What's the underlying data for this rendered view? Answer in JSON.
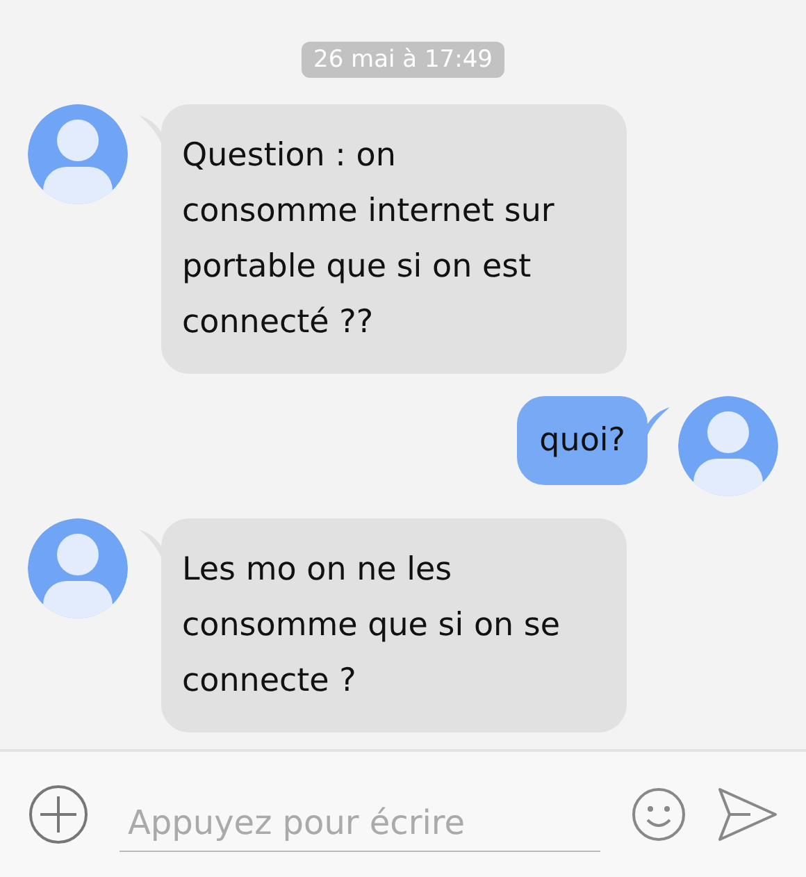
{
  "timestamp": "26 mai à 17:49",
  "messages": [
    {
      "kind": "received",
      "text": "Question : on consomme internet sur portable que si on est connecté ??"
    },
    {
      "kind": "sent",
      "text": "quoi?"
    },
    {
      "kind": "received",
      "text": "Les mo on ne les consomme que si on se connecte ?"
    }
  ],
  "composer": {
    "placeholder": "Appuyez pour écrire"
  }
}
